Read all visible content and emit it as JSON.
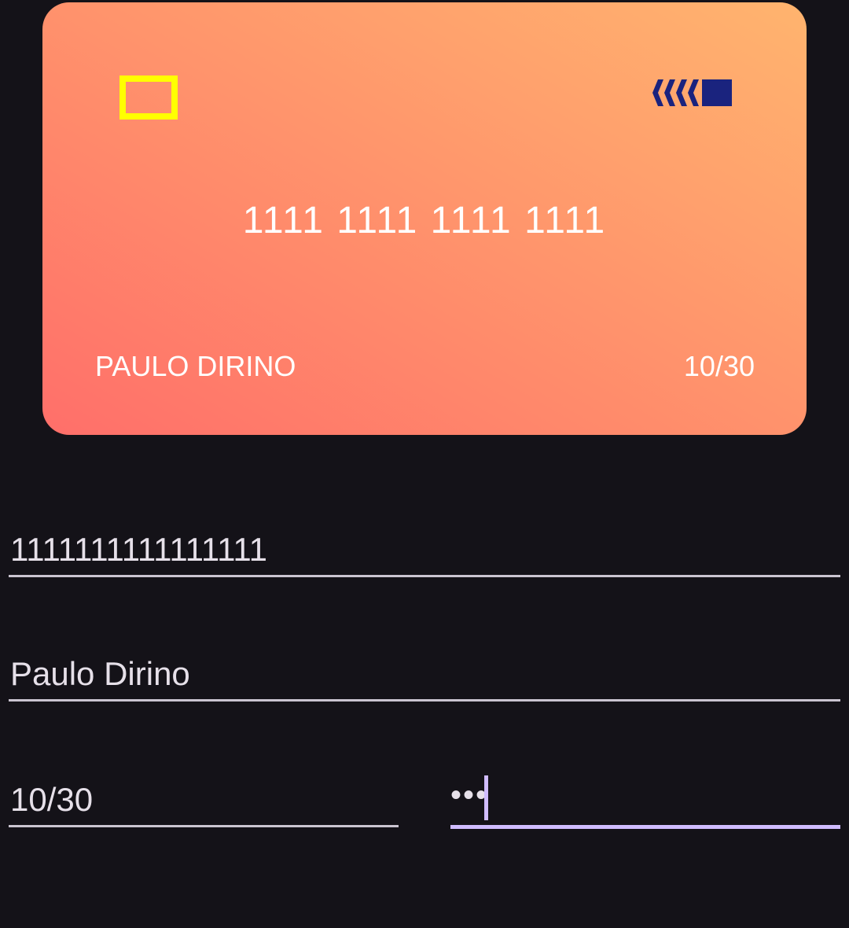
{
  "card": {
    "number": "1111 1111 1111 1111",
    "holder": "PAULO DIRINO",
    "expiry": "10/30",
    "chip_icon": "chip-icon",
    "brand_icon": "card-brand-logo-icon",
    "colors": {
      "gradient_start": "#ff6f6a",
      "gradient_end": "#ffb46e",
      "chip": "#ffff00",
      "brand_logo": "#1a237e"
    }
  },
  "form": {
    "card_number": "1111111111111111",
    "holder_name": "Paulo Dirino",
    "expiry": "10/30",
    "cvv_masked": "•••"
  },
  "theme": {
    "background": "#141218",
    "field_underline": "#cac4d0",
    "focus_color": "#d0bcff"
  }
}
